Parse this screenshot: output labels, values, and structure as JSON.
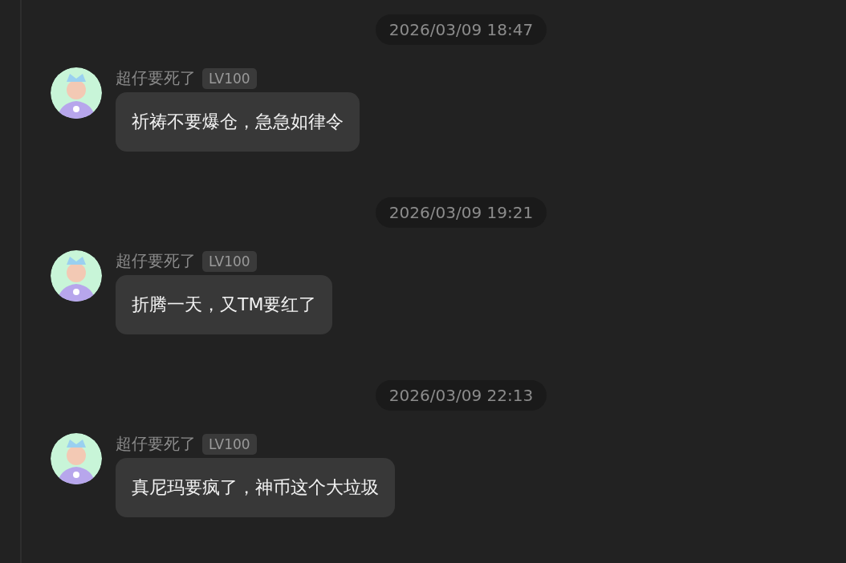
{
  "messages": [
    {
      "time": "2026/03/09 18:47",
      "sender": "超仔要死了",
      "level_badge": "LV100",
      "text": "祈祷不要爆仓，急急如律令"
    },
    {
      "time": "2026/03/09 19:21",
      "sender": "超仔要死了",
      "level_badge": "LV100",
      "text": "折腾一天，又TM要红了"
    },
    {
      "time": "2026/03/09 22:13",
      "sender": "超仔要死了",
      "level_badge": "LV100",
      "text": "真尼玛要疯了，神币这个大垃圾"
    }
  ]
}
